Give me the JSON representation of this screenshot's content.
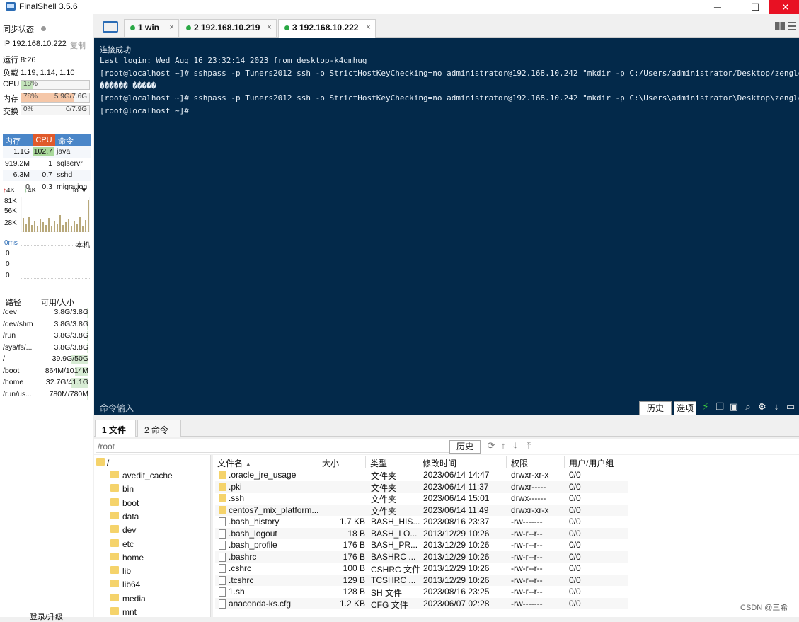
{
  "app": {
    "title": "FinalShell 3.5.6"
  },
  "sidebar": {
    "sync_label": "同步状态",
    "ip": "IP 192.168.10.222",
    "copy": "复制",
    "uptime": "运行 8:26",
    "load": "负载 1.19, 1.14, 1.10",
    "cpu": {
      "label": "CPU",
      "percent_text": "18%",
      "percent": 18
    },
    "mem": {
      "label": "内存",
      "percent_text": "78%",
      "percent": 78,
      "value": "5.9G/7.6G"
    },
    "swap": {
      "label": "交换",
      "percent_text": "0%",
      "percent": 0,
      "value": "0/7.9G"
    },
    "proc_headers": [
      "内存",
      "CPU",
      "命令"
    ],
    "processes": [
      {
        "mem": "1.1G",
        "cpu": "102.7",
        "cmd": "java"
      },
      {
        "mem": "919.2M",
        "cpu": "1",
        "cmd": "sqlservr"
      },
      {
        "mem": "6.3M",
        "cpu": "0.7",
        "cmd": "sshd"
      },
      {
        "mem": "0",
        "cpu": "0.3",
        "cmd": "migration"
      }
    ],
    "net": {
      "up": "4K",
      "down": "4K",
      "iface": "lo",
      "ticks": [
        "81K",
        "56K",
        "28K"
      ]
    },
    "ping": {
      "label": "0ms",
      "host": "本机",
      "ticks": [
        "0",
        "0",
        "0"
      ]
    },
    "disk_headers": [
      "路径",
      "可用/大小"
    ],
    "disks": [
      {
        "path": "/dev",
        "size": "3.8G/3.8G",
        "used": 2
      },
      {
        "path": "/dev/shm",
        "size": "3.8G/3.8G",
        "used": 2
      },
      {
        "path": "/run",
        "size": "3.8G/3.8G",
        "used": 2
      },
      {
        "path": "/sys/fs/...",
        "size": "3.8G/3.8G",
        "used": 2
      },
      {
        "path": "/",
        "size": "39.9G/50G",
        "used": 20
      },
      {
        "path": "/boot",
        "size": "864M/1014M",
        "used": 15
      },
      {
        "path": "/home",
        "size": "32.7G/41.1G",
        "used": 20
      },
      {
        "path": "/run/us...",
        "size": "780M/780M",
        "used": 2
      }
    ],
    "login": "登录/升级"
  },
  "tabs": [
    {
      "label": "1 win"
    },
    {
      "label": "2 192.168.10.219"
    },
    {
      "label": "3 192.168.10.222"
    }
  ],
  "terminal": {
    "lines": [
      "连接成功",
      "Last login: Wed Aug 16 23:32:14 2023 from desktop-k4qmhug",
      "[root@localhost ~]# sshpass -p Tuners2012 ssh -o StrictHostKeyChecking=no administrator@192.168.10.242 \"mkdir -p C:/Users/administrator/Desktop/zenglg\"",
      "������ �����",
      "[root@localhost ~]# sshpass -p Tuners2012 ssh -o StrictHostKeyChecking=no administrator@192.168.10.242 \"mkdir -p C:\\Users\\administrator\\Desktop\\zenglg\"",
      "[root@localhost ~]#"
    ],
    "cmd_label": "命令输入",
    "history_btn": "历史",
    "options_btn": "选项"
  },
  "bottom_tabs": [
    "1 文件",
    "2 命令"
  ],
  "filebrowser": {
    "path": "/root",
    "history_btn": "历史",
    "tree_root": "/",
    "tree": [
      "avedit_cache",
      "bin",
      "boot",
      "data",
      "dev",
      "etc",
      "home",
      "lib",
      "lib64",
      "media",
      "mnt"
    ],
    "columns": [
      "文件名",
      "大小",
      "类型",
      "修改时间",
      "权限",
      "用户/用户组"
    ],
    "files": [
      {
        "name": ".oracle_jre_usage",
        "size": "",
        "type": "文件夹",
        "mtime": "2023/06/14 14:47",
        "perm": "drwxr-xr-x",
        "owner": "0/0",
        "dir": true
      },
      {
        "name": ".pki",
        "size": "",
        "type": "文件夹",
        "mtime": "2023/06/14 11:37",
        "perm": "drwxr-----",
        "owner": "0/0",
        "dir": true
      },
      {
        "name": ".ssh",
        "size": "",
        "type": "文件夹",
        "mtime": "2023/06/14 15:01",
        "perm": "drwx------",
        "owner": "0/0",
        "dir": true
      },
      {
        "name": "centos7_mix_platform...",
        "size": "",
        "type": "文件夹",
        "mtime": "2023/06/14 11:49",
        "perm": "drwxr-xr-x",
        "owner": "0/0",
        "dir": true
      },
      {
        "name": ".bash_history",
        "size": "1.7 KB",
        "type": "BASH_HIS...",
        "mtime": "2023/08/16 23:37",
        "perm": "-rw-------",
        "owner": "0/0",
        "dir": false
      },
      {
        "name": ".bash_logout",
        "size": "18 B",
        "type": "BASH_LO...",
        "mtime": "2013/12/29 10:26",
        "perm": "-rw-r--r--",
        "owner": "0/0",
        "dir": false
      },
      {
        "name": ".bash_profile",
        "size": "176 B",
        "type": "BASH_PR...",
        "mtime": "2013/12/29 10:26",
        "perm": "-rw-r--r--",
        "owner": "0/0",
        "dir": false
      },
      {
        "name": ".bashrc",
        "size": "176 B",
        "type": "BASHRC ...",
        "mtime": "2013/12/29 10:26",
        "perm": "-rw-r--r--",
        "owner": "0/0",
        "dir": false
      },
      {
        "name": ".cshrc",
        "size": "100 B",
        "type": "CSHRC 文件",
        "mtime": "2013/12/29 10:26",
        "perm": "-rw-r--r--",
        "owner": "0/0",
        "dir": false
      },
      {
        "name": ".tcshrc",
        "size": "129 B",
        "type": "TCSHRC ...",
        "mtime": "2013/12/29 10:26",
        "perm": "-rw-r--r--",
        "owner": "0/0",
        "dir": false
      },
      {
        "name": "1.sh",
        "size": "128 B",
        "type": "SH 文件",
        "mtime": "2023/08/16 23:25",
        "perm": "-rw-r--r--",
        "owner": "0/0",
        "dir": false
      },
      {
        "name": "anaconda-ks.cfg",
        "size": "1.2 KB",
        "type": "CFG 文件",
        "mtime": "2023/06/07 02:28",
        "perm": "-rw-------",
        "owner": "0/0",
        "dir": false
      }
    ]
  },
  "watermark": "CSDN @三希"
}
